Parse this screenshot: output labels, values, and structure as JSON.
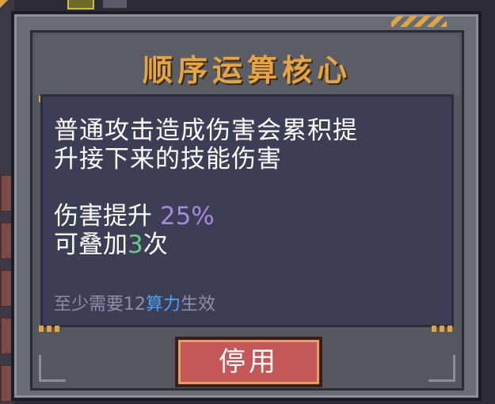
{
  "dialog": {
    "title": "顺序运算核心",
    "description": [
      "普通攻击造成伤害会累积提",
      "升接下来的技能伤害"
    ],
    "damage_boost_label": "伤害提升 ",
    "damage_boost_value": "25%",
    "stack_prefix": "可叠加",
    "stack_count": "3",
    "stack_suffix": "次",
    "requirement_prefix": "至少需要12",
    "requirement_highlight": "算力",
    "requirement_suffix": "生效",
    "disable_button": "停用"
  },
  "colors": {
    "title": "#e6a445",
    "highlight_purple": "#a888d8",
    "highlight_green": "#6fc98a",
    "highlight_blue": "#4d9ff0",
    "button": "#c45858"
  }
}
